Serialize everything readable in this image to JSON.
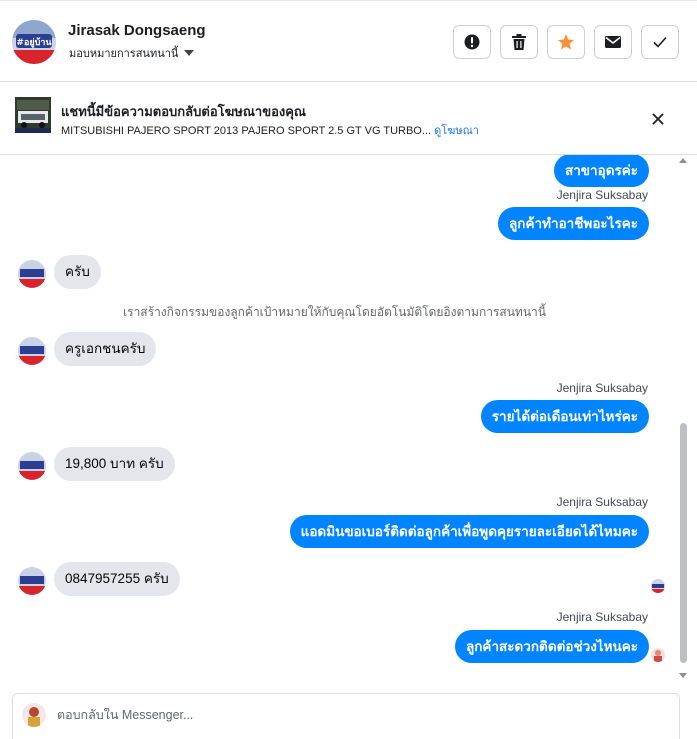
{
  "header": {
    "contact_name": "Jirasak Dongsaeng",
    "assign_label": "มอบหมายการสนทนานี้",
    "actions": [
      {
        "name": "report-icon",
        "color": "#1c1e21"
      },
      {
        "name": "trash-icon",
        "color": "#1c1e21"
      },
      {
        "name": "star-icon",
        "color": "#f7923b"
      },
      {
        "name": "envelope-icon",
        "color": "#1c1e21"
      },
      {
        "name": "check-icon",
        "color": "#1c1e21"
      }
    ]
  },
  "ad_banner": {
    "title": "แชทนี้มีข้อความตอบกลับต่อโฆษณาของคุณ",
    "ad_text": "MITSUBISHI PAJERO SPORT 2013 PAJERO SPORT 2.5 GT VG TURBO...",
    "link_label": "ดูโฆษณา"
  },
  "conversation": {
    "system_message": "เราสร้างกิจกรรมของลูกค้าเป้าหมายให้กับคุณโดยอัตโนมัติโดยอิงตามการสนทนานี้",
    "sender_page": "Jenjira Suksabay",
    "messages": [
      {
        "dir": "out",
        "text": "สาขาอุดรค่ะ"
      },
      {
        "dir": "out",
        "text": "ลูกค้าทำอาชีพอะไรคะ"
      },
      {
        "dir": "in",
        "text": "ครับ"
      },
      {
        "dir": "in",
        "text": "ครูเอกชนครับ"
      },
      {
        "dir": "out",
        "text": "รายได้ต่อเดือนเท่าไหร่คะ"
      },
      {
        "dir": "in",
        "text": "19,800 บาท ครับ"
      },
      {
        "dir": "out",
        "text": "แอดมินขอเบอร์ติดต่อลูกค้าเพื่อพูดคุยรายละเอียดได้ไหมคะ"
      },
      {
        "dir": "in",
        "text": "0847957255 ครับ"
      },
      {
        "dir": "out",
        "text": "ลูกค้าสะดวกติดต่อช่วงไหนคะ"
      }
    ]
  },
  "composer": {
    "placeholder": "ตอบกลับใน Messenger..."
  },
  "colors": {
    "outgoing_bubble": "#0084ff",
    "incoming_bubble": "#e4e6eb",
    "link": "#1877f2",
    "star": "#f7923b"
  }
}
